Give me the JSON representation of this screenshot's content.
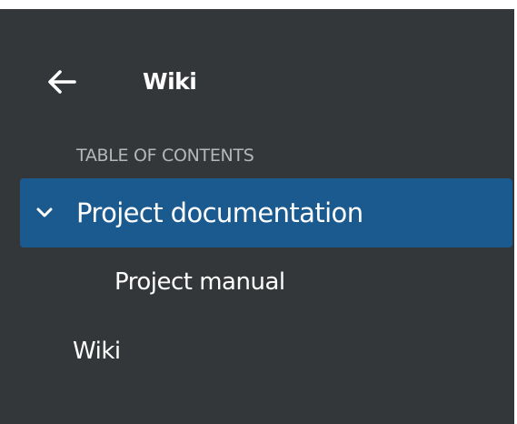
{
  "header": {
    "back_icon": "arrow-left-icon",
    "title": "Wiki"
  },
  "toc": {
    "heading": "TABLE OF CONTENTS",
    "items": [
      {
        "label": "Project documentation",
        "icon": "chevron-down-icon",
        "expanded": true,
        "active": true
      },
      {
        "label": "Project manual",
        "level": 2
      },
      {
        "label": "Wiki",
        "level": 1
      }
    ]
  },
  "colors": {
    "panel_background": "#333739",
    "active_item_background": "#1a5a8f",
    "heading_text": "#b4b8bb",
    "text": "#ffffff"
  }
}
